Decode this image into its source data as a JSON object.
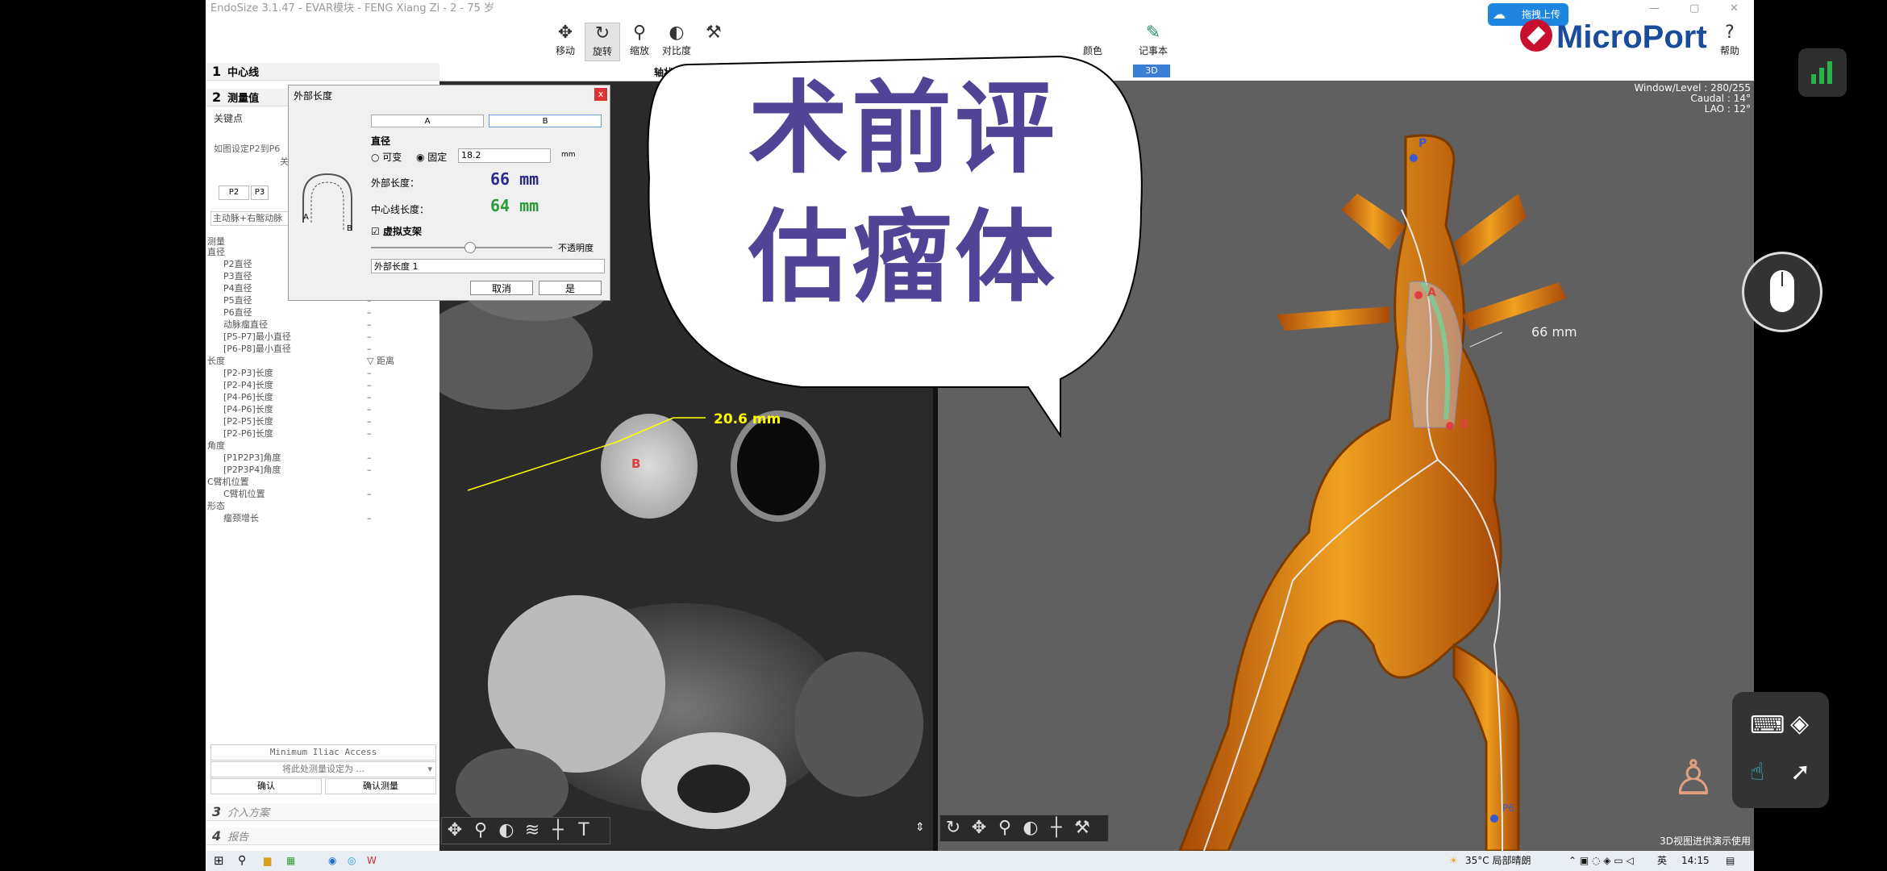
{
  "window": {
    "title": "EndoSize 3.1.47 - EVAR模块 - FENG Xiang Zi - 2 - 75 岁",
    "min": "—",
    "max": "▢",
    "close": "✕"
  },
  "toolbar": {
    "tools": [
      {
        "label": "移动",
        "icon": "✥"
      },
      {
        "label": "旋转",
        "icon": "↻"
      },
      {
        "label": "缩放",
        "icon": "⚲"
      },
      {
        "label": "对比度",
        "icon": "◐"
      }
    ],
    "color_label": "颜色",
    "notes_label": "记事本",
    "help_label": "帮助",
    "upload_label": "拖拽上传",
    "brand": "MicroPort"
  },
  "left_panel": {
    "step1": {
      "num": "1",
      "label": "中心线"
    },
    "step2": {
      "num": "2",
      "label": "测量值"
    },
    "keypoint_label": "关键点",
    "hint_text": "如图设定P2到P6",
    "hint_more": "关",
    "p2": "P2",
    "p3": "P3",
    "vessel_select": "主动脉+右髂动脉",
    "measure_label": "测量",
    "tree": [
      {
        "lvl": 1,
        "text": "直径",
        "dash": ""
      },
      {
        "lvl": 2,
        "text": "P2直径",
        "dash": "–"
      },
      {
        "lvl": 2,
        "text": "P3直径",
        "dash": "–"
      },
      {
        "lvl": 2,
        "text": "P4直径",
        "dash": "–"
      },
      {
        "lvl": 2,
        "text": "P5直径",
        "dash": "–"
      },
      {
        "lvl": 2,
        "text": "P6直径",
        "dash": "–"
      },
      {
        "lvl": 2,
        "text": "动脉瘤直径",
        "dash": "–"
      },
      {
        "lvl": 2,
        "text": "[P5-P7]最小直径",
        "dash": "–"
      },
      {
        "lvl": 2,
        "text": "[P6-P8]最小直径",
        "dash": "–"
      },
      {
        "lvl": 1,
        "text": "长度",
        "dash": "▽ 距离"
      },
      {
        "lvl": 2,
        "text": "[P2-P3]长度",
        "dash": "–"
      },
      {
        "lvl": 2,
        "text": "[P2-P4]长度",
        "dash": "–"
      },
      {
        "lvl": 2,
        "text": "[P4-P6]长度",
        "dash": "–"
      },
      {
        "lvl": 2,
        "text": "[P4-P6]长度",
        "dash": "–"
      },
      {
        "lvl": 2,
        "text": "[P2-P5]长度",
        "dash": "–"
      },
      {
        "lvl": 2,
        "text": "[P2-P6]长度",
        "dash": "–"
      },
      {
        "lvl": 1,
        "text": "角度",
        "dash": ""
      },
      {
        "lvl": 2,
        "text": "[P1P2P3]角度",
        "dash": "–"
      },
      {
        "lvl": 2,
        "text": "[P2P3P4]角度",
        "dash": "–"
      },
      {
        "lvl": 1,
        "text": "C臂机位置",
        "dash": ""
      },
      {
        "lvl": 2,
        "text": "C臂机位置",
        "dash": "–"
      },
      {
        "lvl": 1,
        "text": "形态",
        "dash": ""
      },
      {
        "lvl": 2,
        "text": "瘤颈增长",
        "dash": "–"
      }
    ],
    "min_iliac": "Minimum Iliac Access",
    "set_as": "将此处测量设定为 ...",
    "confirm": "确认",
    "confirm_measure": "确认测量",
    "step3": {
      "num": "3",
      "label": "介入方案"
    },
    "step4": {
      "num": "4",
      "label": "报告"
    }
  },
  "axial_view": {
    "header": "轴状面",
    "diameter_label": "20.6 mm",
    "point_b": "B"
  },
  "dialog": {
    "title": "外部长度",
    "close": "x",
    "btn_a": "A",
    "btn_b": "B",
    "diameter_label": "直径",
    "variable_label": "可变",
    "fixed_label": "固定",
    "fixed_value": "18.2",
    "unit": "mm",
    "outer_length_label": "外部长度：",
    "outer_length_value": "66 mm",
    "center_length_label": "中心线长度：",
    "center_length_value": "64 mm",
    "virtual_stent_label": "虚拟支架",
    "opacity_label": "不透明度",
    "name_value": "外部长度 1",
    "cancel": "取消",
    "ok": "是",
    "illus_a": "A",
    "illus_b": "B"
  },
  "overlay": {
    "line1": "术前评",
    "line2": "估瘤体"
  },
  "view3d": {
    "tab": "3D",
    "window_level": "Window/Level : 280/255",
    "caudal": "Caudal : 14°",
    "lao": "LAO : 12°",
    "measure": "66 mm",
    "p_label": "P",
    "a_label": "A",
    "b_label": "B",
    "p6_label": "P6",
    "footer": "3D视图进供演示使用"
  },
  "taskbar": {
    "weather": "35°C 局部晴朗",
    "lang": "英",
    "time": "14:15"
  }
}
